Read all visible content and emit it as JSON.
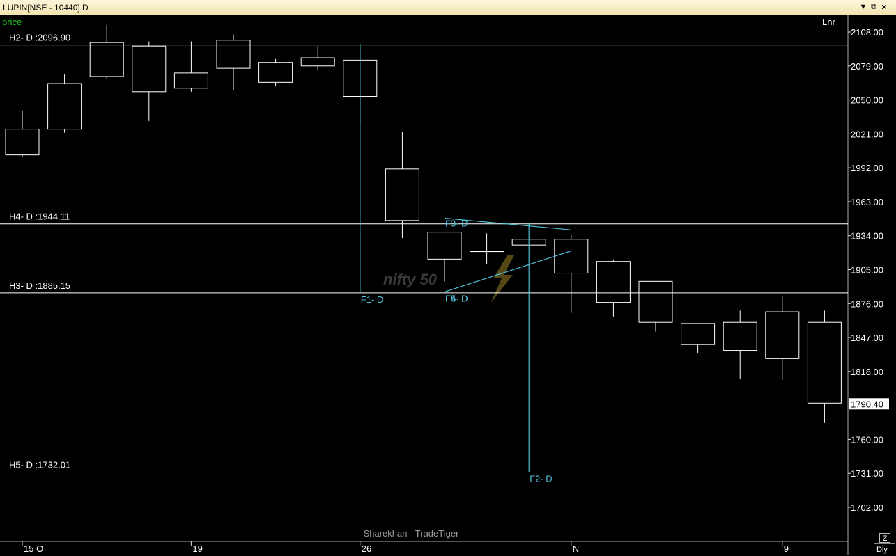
{
  "window": {
    "title": "LUPIN[NSE - 10440] D",
    "minimize_icon": "chevron-down-icon",
    "restore_icon": "restore-window-icon",
    "close_icon": "close-icon"
  },
  "panel": {
    "series_label": "price",
    "scale_label": "Lnr",
    "footer_brand": "Sharekhan - TradeTiger",
    "watermark": "nifty 50",
    "period_button": "Dly",
    "zoom_button": "Z",
    "colors": {
      "background": "#000000",
      "candle": "#ffffff",
      "tool_lines": "#4fc3d9",
      "series_label": "#1fd01f"
    }
  },
  "chart_data": {
    "type": "candlestick",
    "ylim": [
      1680,
      2122
    ],
    "yticks": [
      "2108.00",
      "2079.00",
      "2050.00",
      "2021.00",
      "1992.00",
      "1963.00",
      "1934.00",
      "1905.00",
      "1876.00",
      "1847.00",
      "1818.00",
      "1790.40",
      "1760.00",
      "1731.00",
      "1702.00"
    ],
    "last_price": "1790.40",
    "xlabels": [
      {
        "index": 0,
        "text": "15 O"
      },
      {
        "index": 4,
        "text": "19"
      },
      {
        "index": 8,
        "text": "26"
      },
      {
        "index": 13,
        "text": "N"
      },
      {
        "index": 18,
        "text": "9"
      }
    ],
    "candles": [
      {
        "o": 2003,
        "h": 2041,
        "l": 2001,
        "c": 2025
      },
      {
        "o": 2025,
        "h": 2072,
        "l": 2022,
        "c": 2064
      },
      {
        "o": 2099,
        "h": 2114,
        "l": 2068,
        "c": 2070
      },
      {
        "o": 2096,
        "h": 2100,
        "l": 2032,
        "c": 2057
      },
      {
        "o": 2060,
        "h": 2100,
        "l": 2057,
        "c": 2073
      },
      {
        "o": 2101,
        "h": 2106,
        "l": 2058,
        "c": 2077
      },
      {
        "o": 2065,
        "h": 2085,
        "l": 2062,
        "c": 2082
      },
      {
        "o": 2086,
        "h": 2096,
        "l": 2075,
        "c": 2079
      },
      {
        "o": 2053,
        "h": 2096,
        "l": 2029,
        "c": 2084
      },
      {
        "o": 1947,
        "h": 2023,
        "l": 1932,
        "c": 1991
      },
      {
        "o": 1937,
        "h": 1937,
        "l": 1895,
        "c": 1914
      },
      {
        "o": 1921,
        "h": 1936,
        "l": 1910,
        "c": 1921
      },
      {
        "o": 1926,
        "h": 1931,
        "l": 1926,
        "c": 1931
      },
      {
        "o": 1931,
        "h": 1935,
        "l": 1868,
        "c": 1902
      },
      {
        "o": 1912,
        "h": 1913,
        "l": 1865,
        "c": 1877
      },
      {
        "o": 1895,
        "h": 1895,
        "l": 1852,
        "c": 1860
      },
      {
        "o": 1859,
        "h": 1859,
        "l": 1834,
        "c": 1841
      },
      {
        "o": 1860,
        "h": 1870,
        "l": 1812,
        "c": 1836
      },
      {
        "o": 1829,
        "h": 1882,
        "l": 1811,
        "c": 1869
      },
      {
        "o": 1860,
        "h": 1870,
        "l": 1774,
        "c": 1791
      }
    ],
    "hlines": [
      {
        "label": "H2- D :2096.90",
        "y": 2096.9
      },
      {
        "label": "H4- D :1944.11",
        "y": 1944.11
      },
      {
        "label": "H3- D :1885.15",
        "y": 1885.15
      },
      {
        "label": "H5- D :1732.01",
        "y": 1732.01
      }
    ],
    "vlines": [
      {
        "label": "F1- D",
        "index": 8.0,
        "y_top": 2098,
        "y_bottom": 1885
      },
      {
        "label": "F2- D",
        "index": 12.0,
        "y_top": 1945,
        "y_bottom": 1732
      }
    ],
    "trendlines": [
      {
        "from": {
          "index": 10.0,
          "y": 1949
        },
        "to": {
          "index": 13.0,
          "y": 1939
        }
      },
      {
        "from": {
          "index": 10.0,
          "y": 1886
        },
        "to": {
          "index": 13.0,
          "y": 1921
        }
      }
    ],
    "point_labels": [
      {
        "label": "F3- D",
        "index": 10.0,
        "y": 1949
      },
      {
        "label": "F4- D",
        "index": 10.0,
        "y": 1886
      },
      {
        "label": "F5- D",
        "index": 10.0,
        "y": 1886
      }
    ]
  }
}
